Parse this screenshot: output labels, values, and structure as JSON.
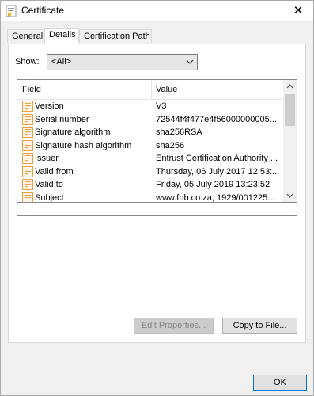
{
  "window": {
    "title": "Certificate",
    "close_glyph": "✕"
  },
  "tabs": [
    {
      "label": "General",
      "active": false
    },
    {
      "label": "Details",
      "active": true
    },
    {
      "label": "Certification Path",
      "active": false
    }
  ],
  "show": {
    "label": "Show:",
    "value": "<All>"
  },
  "list": {
    "columns": {
      "field": "Field",
      "value": "Value"
    },
    "rows": [
      {
        "field": "Version",
        "value": "V3"
      },
      {
        "field": "Serial number",
        "value": "72544f4f477e4f56000000005..."
      },
      {
        "field": "Signature algorithm",
        "value": "sha256RSA"
      },
      {
        "field": "Signature hash algorithm",
        "value": "sha256"
      },
      {
        "field": "Issuer",
        "value": "Entrust Certification Authority ..."
      },
      {
        "field": "Valid from",
        "value": "Thursday, 06 July 2017 12:53:..."
      },
      {
        "field": "Valid to",
        "value": "Friday, 05 July 2019 13:23:52"
      },
      {
        "field": "Subject",
        "value": "www.fnb.co.za, 1929/001225..."
      }
    ]
  },
  "buttons": {
    "edit_properties": "Edit Properties...",
    "copy_to_file": "Copy to File...",
    "ok": "OK"
  },
  "colors": {
    "accent": "#0078d7",
    "field_icon": "#e8a040"
  }
}
